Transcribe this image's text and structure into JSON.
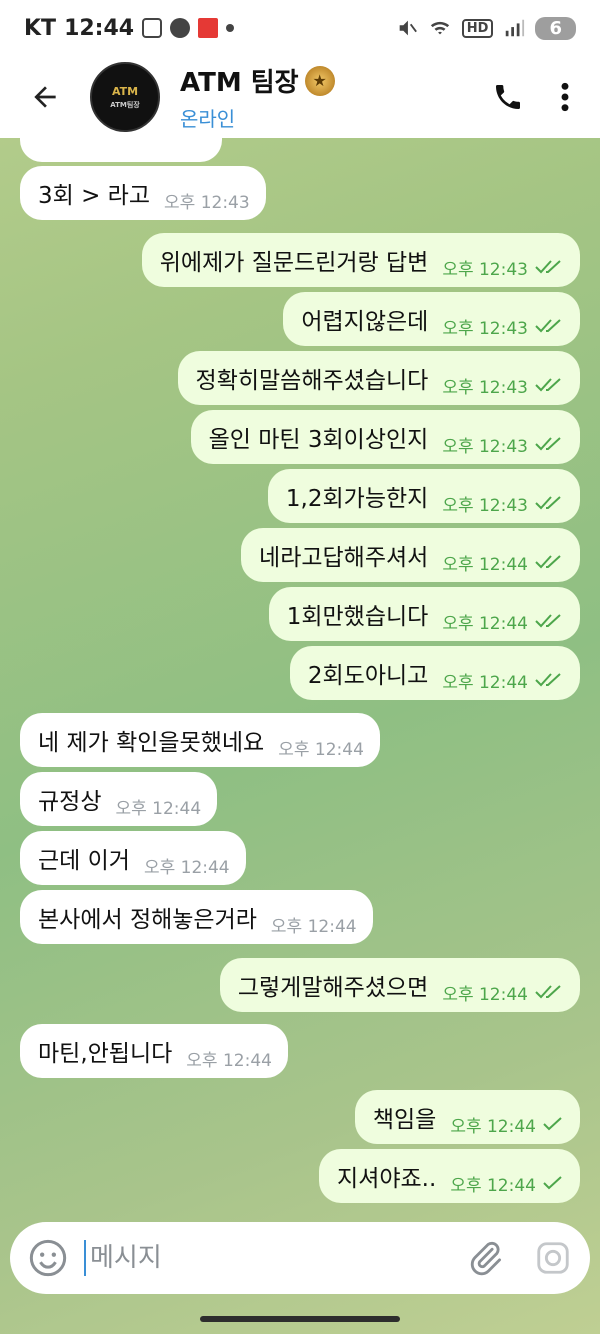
{
  "status_bar": {
    "carrier": "KT",
    "clock": "12:44",
    "battery": "6"
  },
  "header": {
    "title": "ATM 팀장",
    "status": "온라인",
    "avatar_text": "ATM",
    "avatar_sub": "ATM팀장"
  },
  "messages": [
    {
      "dir": "in",
      "text": "3회 > 라고",
      "time": "오후 12:43"
    },
    {
      "dir": "out",
      "text": "위에제가 질문드린거랑 답변",
      "time": "오후 12:43",
      "read": true
    },
    {
      "dir": "out",
      "text": "어렵지않은데",
      "time": "오후 12:43",
      "read": true
    },
    {
      "dir": "out",
      "text": "정확히말씀해주셨습니다",
      "time": "오후 12:43",
      "read": true
    },
    {
      "dir": "out",
      "text": "올인 마틴 3회이상인지",
      "time": "오후 12:43",
      "read": true
    },
    {
      "dir": "out",
      "text": "1,2회가능한지",
      "time": "오후 12:43",
      "read": true
    },
    {
      "dir": "out",
      "text": "네라고답해주셔서",
      "time": "오후 12:44",
      "read": true
    },
    {
      "dir": "out",
      "text": "1회만했습니다",
      "time": "오후 12:44",
      "read": true
    },
    {
      "dir": "out",
      "text": "2회도아니고",
      "time": "오후 12:44",
      "read": true
    },
    {
      "dir": "in",
      "text": "네 제가 확인을못했네요",
      "time": "오후 12:44"
    },
    {
      "dir": "in",
      "text": "규정상",
      "time": "오후 12:44"
    },
    {
      "dir": "in",
      "text": "근데 이거",
      "time": "오후 12:44"
    },
    {
      "dir": "in",
      "text": "본사에서 정해놓은거라",
      "time": "오후 12:44"
    },
    {
      "dir": "out",
      "text": "그렇게말해주셨으면",
      "time": "오후 12:44",
      "read": true
    },
    {
      "dir": "in",
      "text": "마틴,안됩니다",
      "time": "오후 12:44"
    },
    {
      "dir": "out",
      "text": "책임을",
      "time": "오후 12:44",
      "read": false
    },
    {
      "dir": "out",
      "text": "지셔야죠..",
      "time": "오후 12:44",
      "read": false
    }
  ],
  "composer": {
    "placeholder": "메시지"
  },
  "colors": {
    "accent": "#3a8fd6",
    "out_bubble": "#effdde",
    "out_time": "#4da64b",
    "in_bubble": "#ffffff"
  }
}
